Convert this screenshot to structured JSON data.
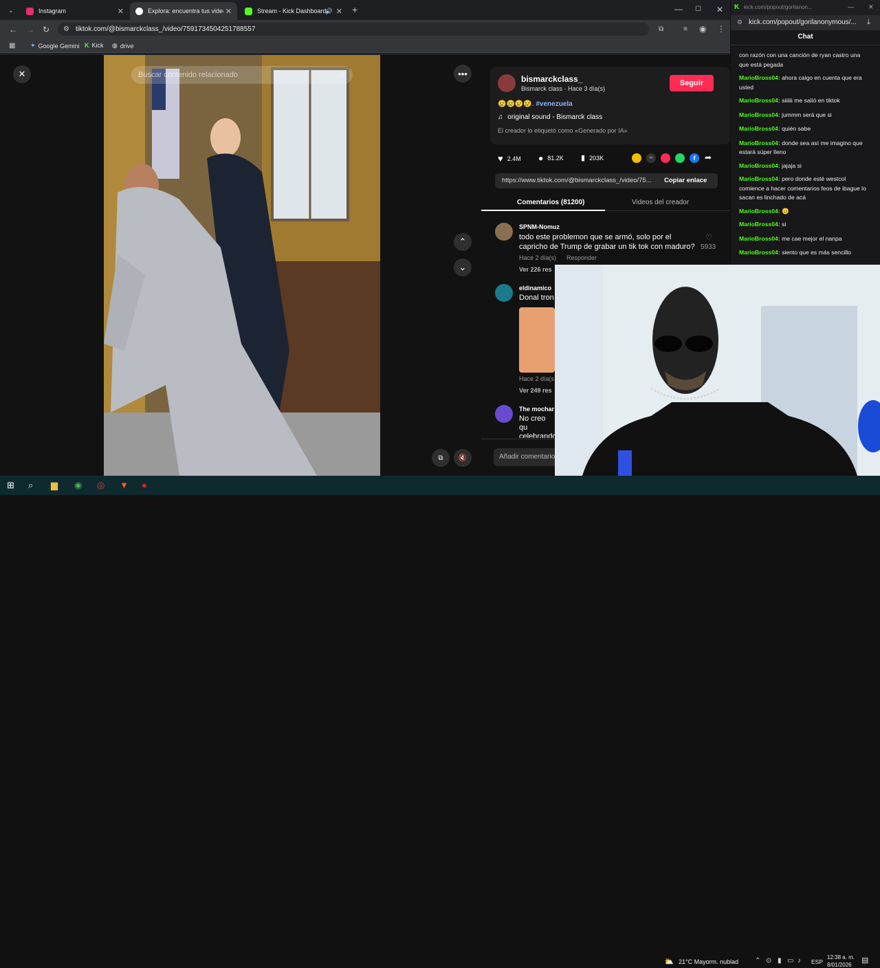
{
  "browser": {
    "tabs": [
      {
        "title": "Instagram",
        "color": "#e1306c"
      },
      {
        "title": "Explora: encuentra tus videos fa",
        "color": "#ffffff"
      },
      {
        "title": "Stream - Kick Dashboard",
        "color": "#53fc18"
      }
    ],
    "url": "tiktok.com/@bismarckclass_/video/7591734504251788557",
    "bookmarks": [
      "Google Gemini",
      "Kick",
      "drive"
    ]
  },
  "tiktok": {
    "search_placeholder": "Buscar contenido relacionado",
    "username": "bismarckclass_",
    "subtitle": "Bismarck class · Hace 3 día(s)",
    "follow_label": "Seguir",
    "caption_emojis": "😢😢😢😢.",
    "hashtag": "#venezuela",
    "sound": "original sound - Bismarck class",
    "ai_label": "El creador lo etiquetó como «Generado por IA»",
    "likes": "2.4M",
    "comments_count": "81.2K",
    "saves": "203K",
    "link_url": "https://www.tiktok.com/@bismarckclass_/video/75...",
    "copy_link_label": "Copiar enlace",
    "tab_comments": "Comentarios (81200)",
    "tab_creator": "Videos del creador",
    "comment_input_placeholder": "Añadir comentario...",
    "comments": [
      {
        "user": "SPNM-Nomuz",
        "text": "todo este problemon que se armó, solo por el capricho de Trump de grabar un tik tok con maduro?",
        "time": "Hace 2 día(s)",
        "reply": "Responder",
        "likes": "5933",
        "replies": "Ver 226 res"
      },
      {
        "user": "eldinamico",
        "text": "Donal tron",
        "time": "Hace 2 día(s",
        "replies": "Ver 249 res"
      },
      {
        "user": "The mochar",
        "text": "No creo qu celebrando empezó a"
      }
    ]
  },
  "chat": {
    "url": "kick.com/popout/gorilanonymous/...",
    "url_faded": "kick.com/popout/gorilanon...",
    "title": "Chat",
    "messages": [
      {
        "user": "",
        "text": "con razón con una canción de ryan castro una que está pegada"
      },
      {
        "user": "MarioBross04:",
        "text": " ahora caigo en cuenta que era usted"
      },
      {
        "user": "MarioBross04:",
        "text": " siiiiii me salió en tiktok"
      },
      {
        "user": "MarioBross04:",
        "text": " jummm será que si"
      },
      {
        "user": "MarioBross04:",
        "text": " quién sabe"
      },
      {
        "user": "MarioBross04:",
        "text": " donde sea así me imagino que estará súper lleno"
      },
      {
        "user": "MarioBross04:",
        "text": " jajaja si"
      },
      {
        "user": "MarioBross04:",
        "text": " pero donde esté westcol comience a hacer comentarios feos de ibague lo sacan es linchado de acá"
      },
      {
        "user": "MarioBross04:",
        "text": " 😐"
      },
      {
        "user": "MarioBross04:",
        "text": " si"
      },
      {
        "user": "MarioBross04:",
        "text": " me cae mejor el nanpa"
      },
      {
        "user": "MarioBross04:",
        "text": " siento que es más sencillo"
      }
    ]
  },
  "taskbar": {
    "weather": "21°C  Mayorm. nublad",
    "lang": "ESP",
    "time": "12:38 a. m.",
    "date": "8/01/2026"
  }
}
